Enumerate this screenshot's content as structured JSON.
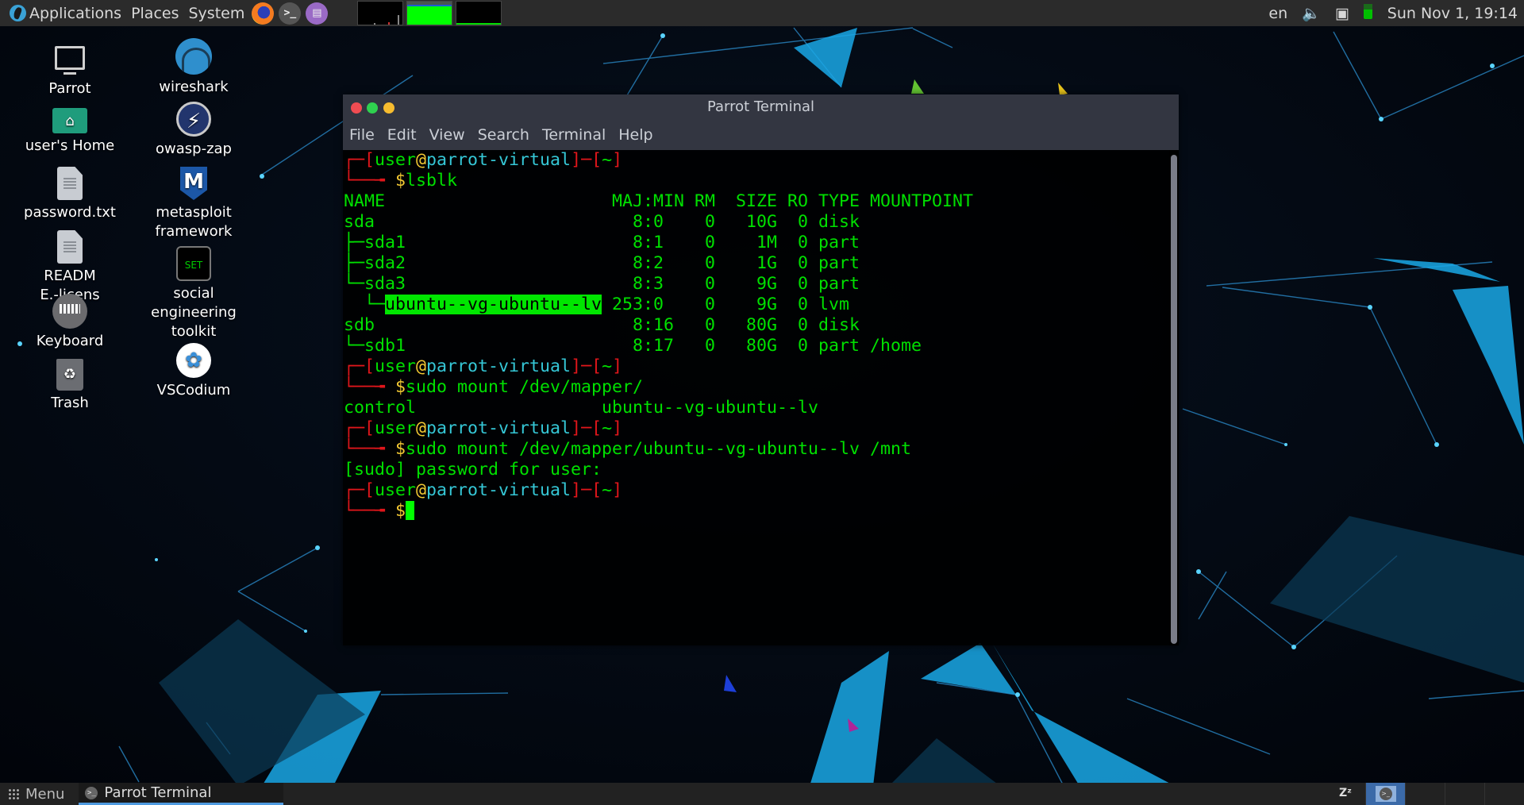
{
  "top_panel": {
    "menus": [
      "Applications",
      "Places",
      "System"
    ],
    "launchers": [
      "firefox-launcher",
      "terminal-launcher",
      "text-editor-launcher"
    ],
    "keyboard_layout": "en",
    "clock": "Sun Nov  1, 19:14",
    "memory_usage_fraction": 0.8
  },
  "desktop_icons": [
    {
      "label": "Parrot",
      "icon": "computer-icon"
    },
    {
      "label": "user's Home",
      "icon": "home-folder-icon"
    },
    {
      "label": "password.txt",
      "icon": "text-file-icon"
    },
    {
      "label": "README.-license",
      "icon": "text-file-icon"
    },
    {
      "label": "Keyboard",
      "icon": "keyboard-icon"
    },
    {
      "label": "Trash",
      "icon": "trash-icon"
    },
    {
      "label": "wireshark",
      "icon": "wireshark-icon"
    },
    {
      "label": "owasp-zap",
      "icon": "owasp-zap-icon"
    },
    {
      "label": "metasploit framework",
      "icon": "metasploit-icon"
    },
    {
      "label": "social engineering toolkit",
      "icon": "set-icon"
    },
    {
      "label": "VSCodium",
      "icon": "vscodium-icon"
    }
  ],
  "terminal": {
    "title": "Parrot Terminal",
    "menu": [
      "File",
      "Edit",
      "View",
      "Search",
      "Terminal",
      "Help"
    ],
    "prompt": {
      "user": "user",
      "host": "parrot-virtual",
      "dir": "~"
    },
    "commands": [
      "lsblk",
      "sudo mount /dev/mapper/",
      "sudo mount /dev/mapper/ubuntu--vg-ubuntu--lv /mnt"
    ],
    "lsblk_header": "NAME                      MAJ:MIN RM  SIZE RO TYPE MOUNTPOINT",
    "lsblk_rows": [
      {
        "name": "sda",
        "tree": "",
        "rest": "                         8:0    0   10G  0 disk "
      },
      {
        "name": "sda1",
        "tree": "├─",
        "rest": "                      8:1    0    1M  0 part "
      },
      {
        "name": "sda2",
        "tree": "├─",
        "rest": "                      8:2    0    1G  0 part "
      },
      {
        "name": "sda3",
        "tree": "└─",
        "rest": "                      8:3    0    9G  0 part "
      },
      {
        "name": "ubuntu--vg-ubuntu--lv",
        "tree": "  └─",
        "rest": " 253:0    0    9G  0 lvm  ",
        "highlighted": true
      },
      {
        "name": "sdb",
        "tree": "",
        "rest": "                         8:16   0   80G  0 disk "
      },
      {
        "name": "sdb1",
        "tree": "└─",
        "rest": "                      8:17   0   80G  0 part /home"
      }
    ],
    "completion_output": "control                  ubuntu--vg-ubuntu--lv",
    "sudo_prompt": "[sudo] password for user:"
  },
  "bottom_panel": {
    "menu_label": "Menu",
    "tasks": [
      {
        "label": "Parrot Terminal",
        "active": true
      }
    ],
    "workspaces": 4,
    "active_workspace": 1
  }
}
